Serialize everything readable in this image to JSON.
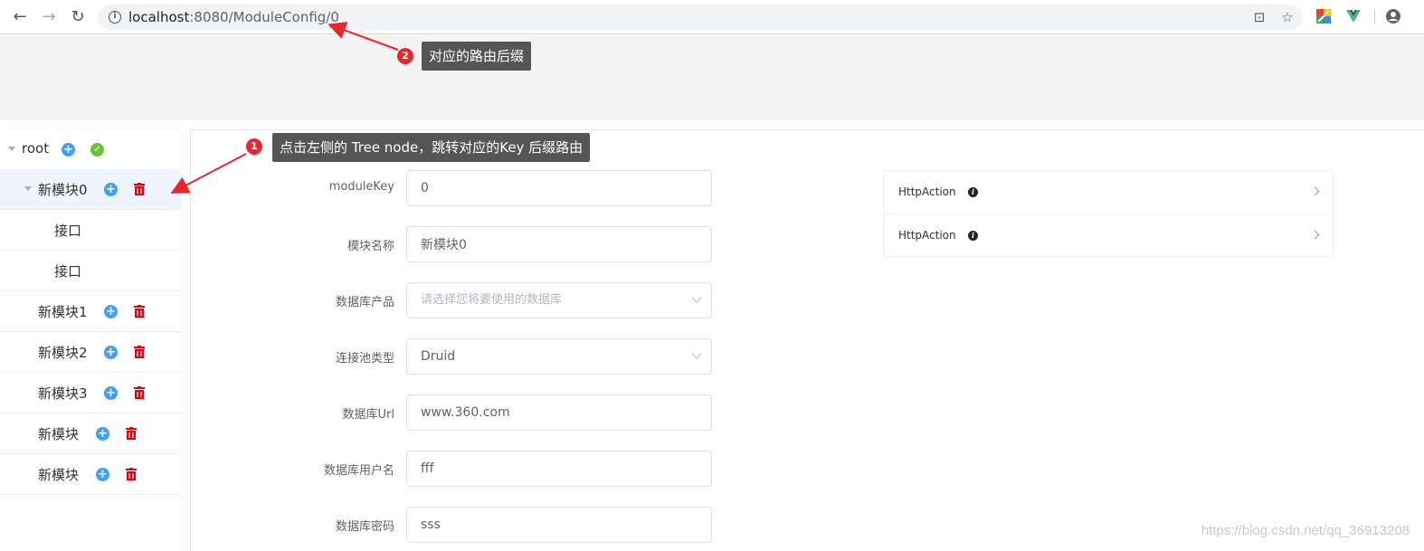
{
  "browser": {
    "url_host": "localhost",
    "url_rest": ":8080/ModuleConfig/0"
  },
  "tree": {
    "root_label": "root",
    "nodes": [
      {
        "label": "新模块0"
      },
      {
        "label": "接口"
      },
      {
        "label": "接口"
      },
      {
        "label": "新模块1"
      },
      {
        "label": "新模块2"
      },
      {
        "label": "新模块3"
      },
      {
        "label": "新模块"
      },
      {
        "label": "新模块"
      }
    ]
  },
  "form": {
    "fields": [
      {
        "label": "moduleKey",
        "value": "0"
      },
      {
        "label": "模块名称",
        "value": "新模块0"
      },
      {
        "label": "数据库产品",
        "placeholder": "请选择您将要使用的数据库"
      },
      {
        "label": "连接池类型",
        "value": "Druid"
      },
      {
        "label": "数据库Url",
        "value": "www.360.com"
      },
      {
        "label": "数据库用户名",
        "value": "fff"
      },
      {
        "label": "数据库密码",
        "value": "sss"
      }
    ]
  },
  "actions": [
    {
      "label": "HttpAction"
    },
    {
      "label": "HttpAction"
    }
  ],
  "annotations": [
    {
      "number": "1",
      "text": "点击左侧的 Tree node，跳转对应的Key 后缀路由"
    },
    {
      "number": "2",
      "text": "对应的路由后缀"
    }
  ],
  "watermark": "https://blog.csdn.net/qq_36913208",
  "colors": {
    "primary": "#409eff",
    "success": "#67c23a",
    "danger": "#e60012",
    "annotation": "#e8262c",
    "callout_bg": "#555555"
  }
}
